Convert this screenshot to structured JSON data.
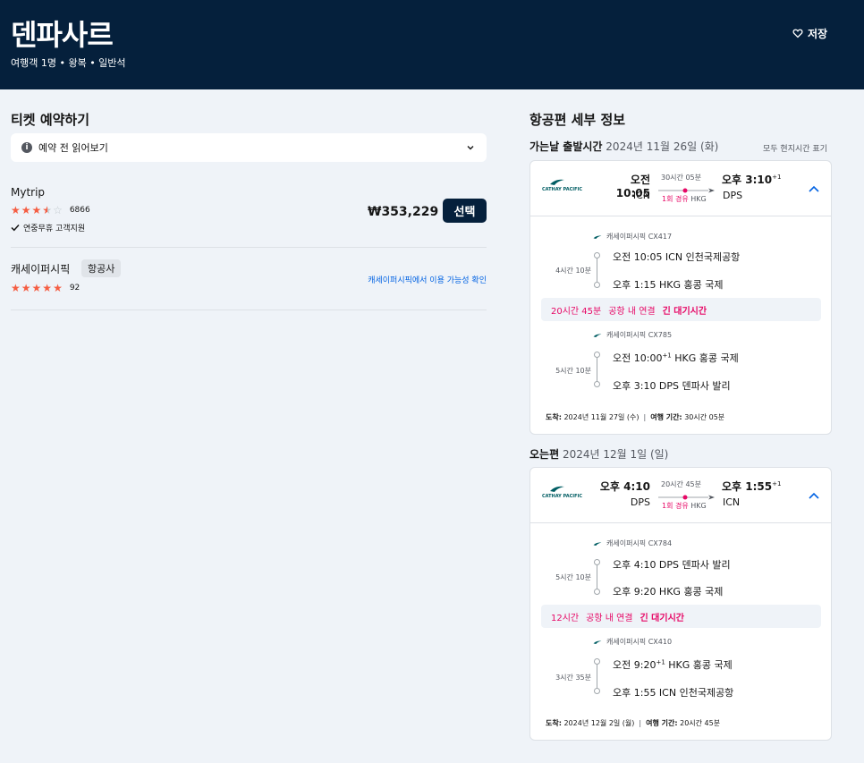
{
  "header": {
    "title": "덴파사르",
    "subtitle": "여행객 1명 • 왕복 • 일반석",
    "save_label": "저장"
  },
  "booking": {
    "title": "티켓 예약하기",
    "notice_label": "예약 전 읽어보기",
    "vendors": [
      {
        "name": "Mytrip",
        "rating": 3.5,
        "review_count": "6866",
        "support": "연중무휴 고객지원",
        "price": "₩353,229",
        "button_label": "선택"
      },
      {
        "name": "캐세이퍼시픽",
        "badge": "항공사",
        "rating": 5,
        "review_count": "92",
        "link": "캐세이퍼시픽에서 이용 가능성 확인"
      }
    ]
  },
  "details": {
    "title": "항공편 세부 정보",
    "timezone_note": "모두 현지시간 표기",
    "outbound": {
      "label": "가는날 출발시간",
      "date": "2024년 11월 26일 (화)",
      "airline_logo_text": "CATHAY PACIFIC",
      "dep_time": "오전 10:05",
      "dep_code": "ICN",
      "arr_time": "오후 3:10",
      "arr_plus": "+1",
      "arr_code": "DPS",
      "duration": "30시간 05분",
      "stops": "1회 경유",
      "via": "HKG",
      "segments": [
        {
          "carrier": "캐세이퍼시픽 CX417",
          "duration": "4시간 10분",
          "from": "오전 10:05 ICN 인천국제공항",
          "to_time": "오후 1:15",
          "to_rest": "HKG 홍콩 국제",
          "to_plus": ""
        },
        {
          "carrier": "캐세이퍼시픽 CX785",
          "duration": "5시간 10분",
          "from_time": "오전 10:00",
          "from_plus": "+1",
          "from_rest": "HKG 홍콩 국제",
          "to": "오후 3:10 DPS 덴파사 발리"
        }
      ],
      "layover": {
        "duration": "20시간 45분",
        "type": "공항 내 연결",
        "warning": "긴 대기시간"
      },
      "arrive_label": "도착:",
      "arrive_date": "2024년 11월 27일 (수)",
      "total_label": "여행 기간:",
      "total": "30시간 05분"
    },
    "inbound": {
      "label": "오는편",
      "date": "2024년 12월 1일 (일)",
      "airline_logo_text": "CATHAY PACIFIC",
      "dep_time": "오후 4:10",
      "dep_code": "DPS",
      "arr_time": "오후 1:55",
      "arr_plus": "+1",
      "arr_code": "ICN",
      "duration": "20시간 45분",
      "stops": "1회 경유",
      "via": "HKG",
      "segments": [
        {
          "carrier": "캐세이퍼시픽 CX784",
          "duration": "5시간 10분",
          "from": "오후 4:10 DPS 덴파사 발리",
          "to": "오후 9:20 HKG 홍콩 국제"
        },
        {
          "carrier": "캐세이퍼시픽 CX410",
          "duration": "3시간 35분",
          "from_time": "오전 9:20",
          "from_plus": "+1",
          "from_rest": "HKG 홍콩 국제",
          "to": "오후 1:55 ICN 인천국제공항"
        }
      ],
      "layover": {
        "duration": "12시간",
        "type": "공항 내 연결",
        "warning": "긴 대기시간"
      },
      "arrive_label": "도착:",
      "arrive_date": "2024년 12월 2일 (월)",
      "total_label": "여행 기간:",
      "total": "20시간 45분"
    }
  },
  "colors": {
    "header_bg": "#05203c",
    "page_bg": "#eff3f8",
    "star": "#f55d42",
    "alert": "#e70866",
    "link": "#0062e3",
    "cathay": "#005d63"
  }
}
